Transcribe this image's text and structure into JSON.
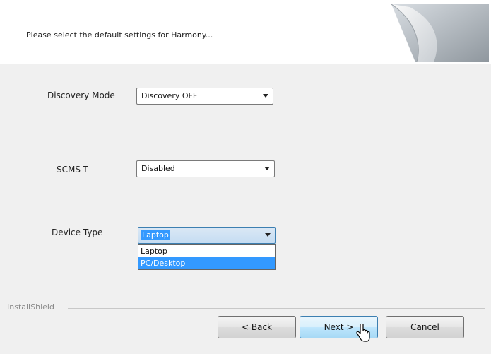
{
  "header": {
    "text": "Please select the default settings for Harmony..."
  },
  "fields": {
    "discovery_mode": {
      "label": "Discovery Mode",
      "value": "Discovery OFF"
    },
    "scms_t": {
      "label": "SCMS-T",
      "value": "Disabled"
    },
    "device_type": {
      "label": "Device Type",
      "value": "Laptop",
      "options": [
        "Laptop",
        "PC/Desktop"
      ],
      "highlighted": "PC/Desktop"
    }
  },
  "footer": {
    "brand": "InstallShield"
  },
  "buttons": {
    "back": "< Back",
    "next": "Next >",
    "cancel": "Cancel"
  }
}
